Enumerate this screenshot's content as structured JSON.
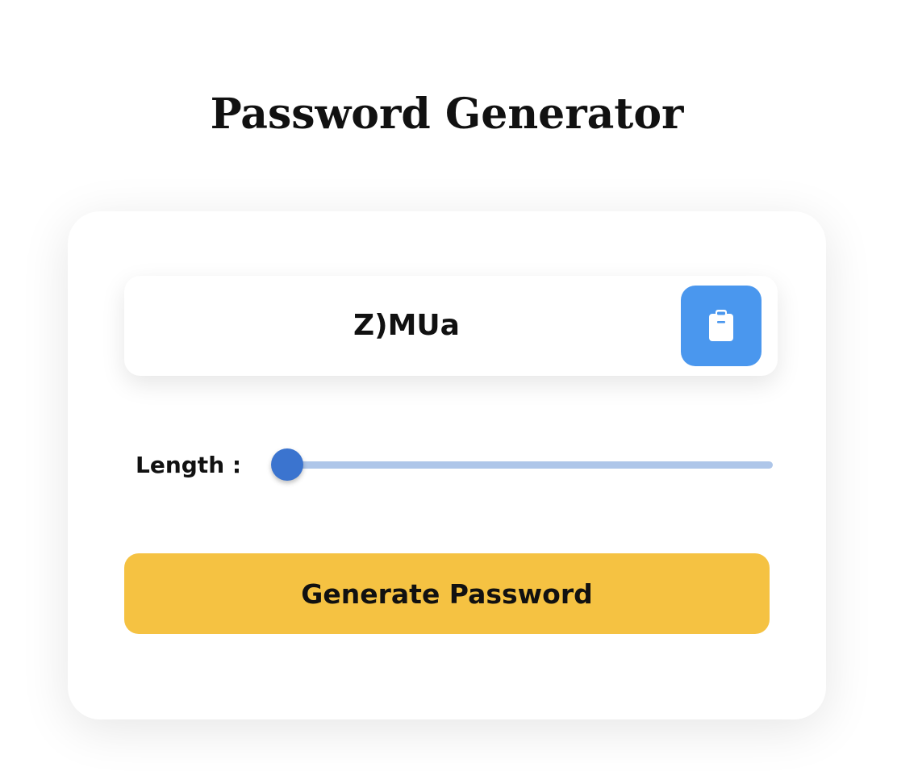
{
  "header": {
    "title": "Password Generator"
  },
  "display": {
    "password": "Z)MUa",
    "copy_icon": "clipboard-icon"
  },
  "length": {
    "label": "Length :",
    "slider_fraction": 0.0
  },
  "actions": {
    "generate_label": "Generate Password"
  },
  "colors": {
    "accent_blue": "#4a97ee",
    "slider_blue": "#3b74cf",
    "slider_track": "#aec6e9",
    "button_yellow": "#f5c242"
  }
}
